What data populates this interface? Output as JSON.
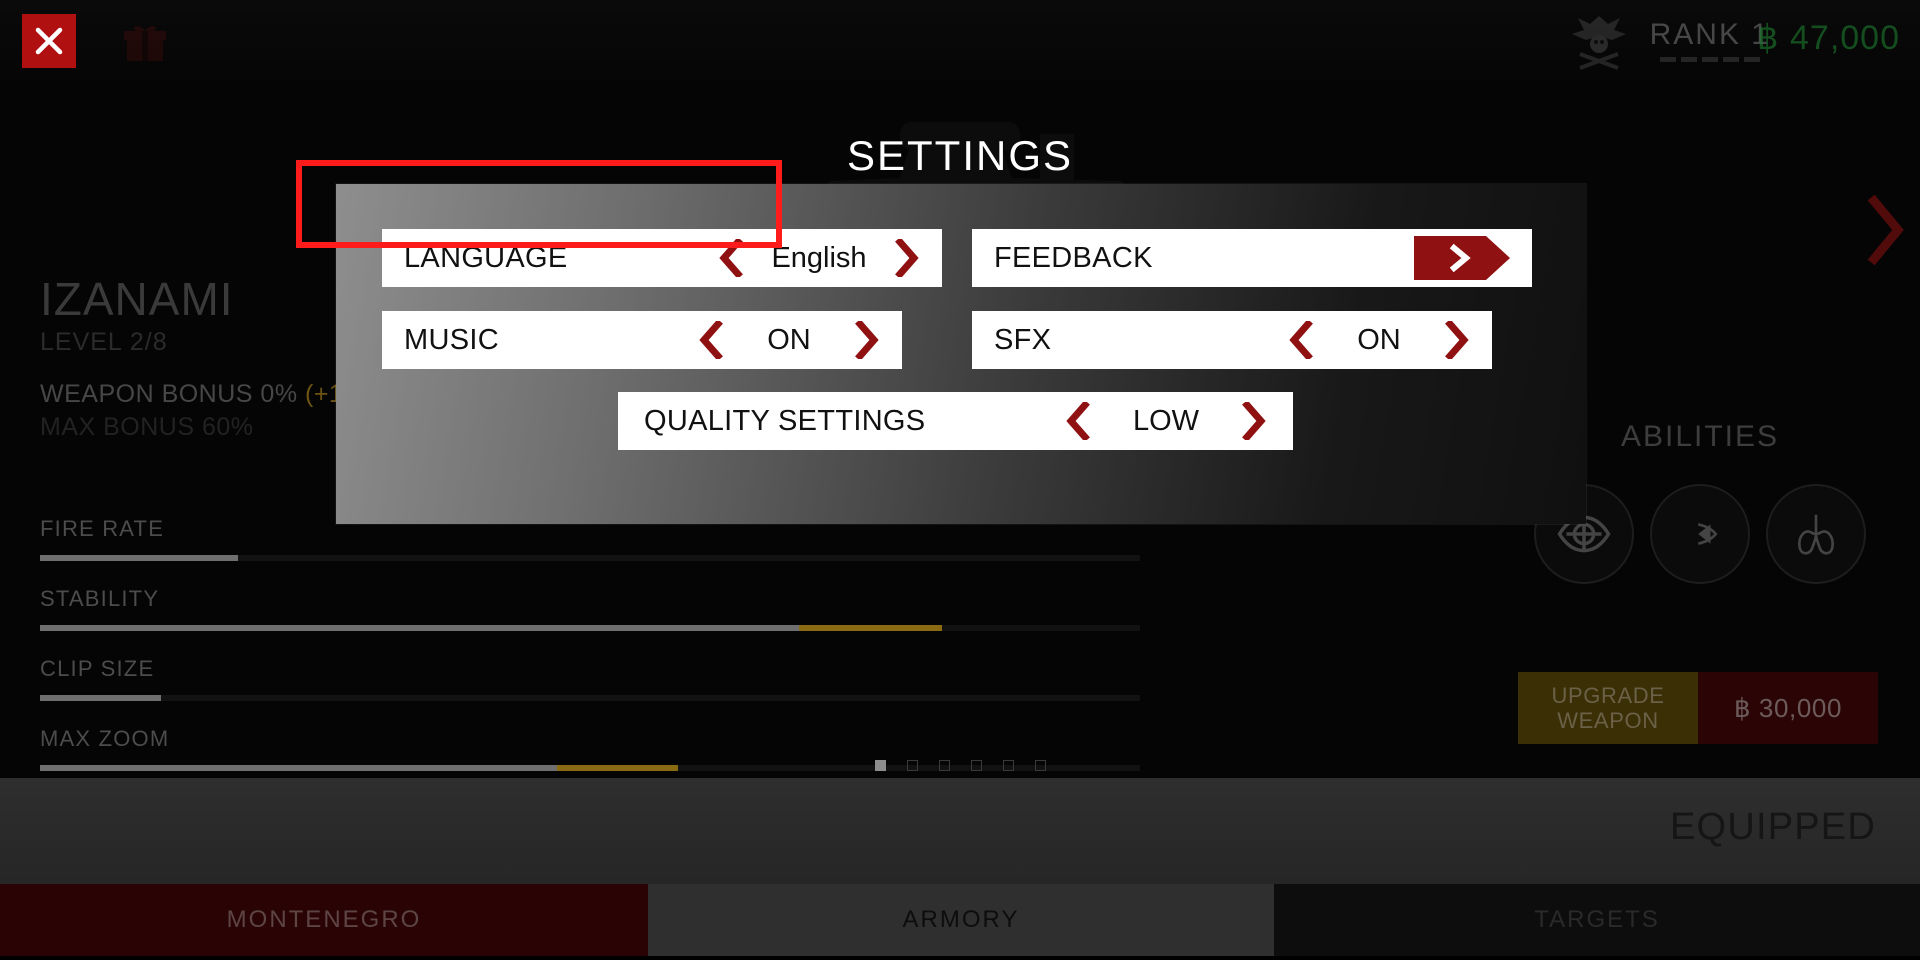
{
  "topbar": {
    "close_label": "close-icon",
    "gift_label": "gift-icon",
    "rank_label": "RANK 1",
    "rank_pip_count": 5,
    "currency": "฿ 47,000",
    "currency_color": "#1c7a2e"
  },
  "weapon": {
    "name": "IZANAMI",
    "level": "LEVEL 2/8",
    "weapon_bonus": "WEAPON BONUS 0% ",
    "weapon_bonus_plus": "(+1",
    "max_bonus": "MAX BONUS 60%",
    "stats": [
      {
        "label": "FIRE RATE",
        "fill_pct": 18,
        "bonus_start_pct": 18,
        "bonus_pct": 0
      },
      {
        "label": "STABILITY",
        "fill_pct": 69,
        "bonus_start_pct": 69,
        "bonus_pct": 13
      },
      {
        "label": "CLIP SIZE",
        "fill_pct": 11,
        "bonus_start_pct": 11,
        "bonus_pct": 0
      },
      {
        "label": "MAX ZOOM",
        "fill_pct": 47,
        "bonus_start_pct": 47,
        "bonus_pct": 11
      }
    ]
  },
  "pagination": {
    "total": 6,
    "active_index": 0
  },
  "abilities": {
    "title": "ABILITIES",
    "items": [
      {
        "name": "scope-eye-icon"
      },
      {
        "name": "bullet-icon"
      },
      {
        "name": "lungs-icon"
      }
    ]
  },
  "upgrade": {
    "label_line1": "UPGRADE",
    "label_line2": "WEAPON",
    "price": "฿ 30,000"
  },
  "equipped": {
    "label": "EQUIPPED"
  },
  "tabs": [
    {
      "label": "MONTENEGRO",
      "active": false
    },
    {
      "label": "ARMORY",
      "active": true
    },
    {
      "label": "TARGETS",
      "active": false
    }
  ],
  "settings": {
    "title": "SETTINGS",
    "rows": {
      "language": {
        "label": "LANGUAGE",
        "value": "English",
        "prev": "prev-chevron-icon",
        "next": "next-chevron-icon"
      },
      "feedback": {
        "label": "FEEDBACK",
        "button": "feedback-arrow-button"
      },
      "music": {
        "label": "MUSIC",
        "value": "ON",
        "prev": "prev-chevron-icon",
        "next": "next-chevron-icon"
      },
      "sfx": {
        "label": "SFX",
        "value": "ON",
        "prev": "prev-chevron-icon",
        "next": "next-chevron-icon"
      },
      "quality": {
        "label": "QUALITY SETTINGS",
        "value": "LOW",
        "prev": "prev-chevron-icon",
        "next": "next-chevron-icon"
      }
    },
    "highlight_color": "#fe1b1b",
    "accent_color": "#8f1111"
  }
}
